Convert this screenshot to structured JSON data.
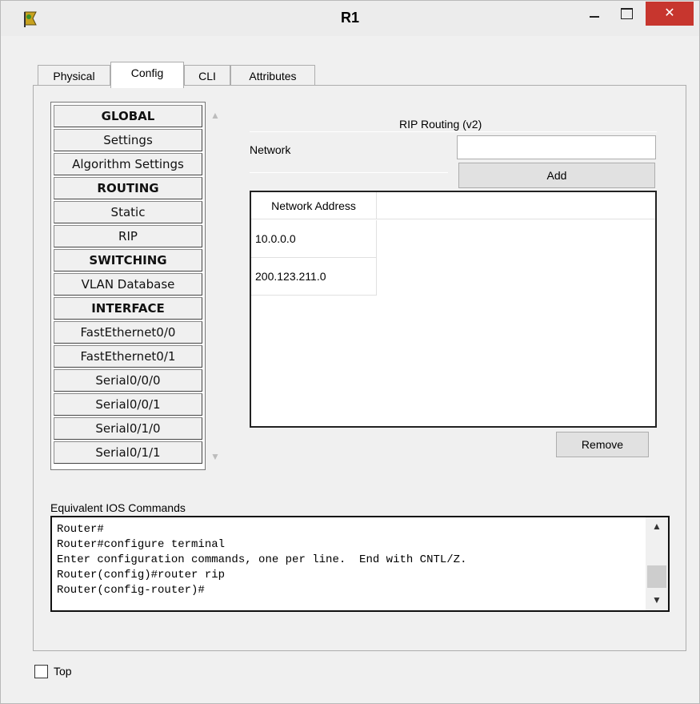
{
  "window": {
    "title": "R1",
    "icon": "router-app-icon",
    "close_glyph": "✕"
  },
  "tabs": [
    {
      "label": "Physical"
    },
    {
      "label": "Config"
    },
    {
      "label": "CLI"
    },
    {
      "label": "Attributes"
    }
  ],
  "active_tab": "Config",
  "nav": {
    "items": [
      {
        "label": "GLOBAL",
        "header": true
      },
      {
        "label": "Settings"
      },
      {
        "label": "Algorithm Settings"
      },
      {
        "label": "ROUTING",
        "header": true
      },
      {
        "label": "Static"
      },
      {
        "label": "RIP"
      },
      {
        "label": "SWITCHING",
        "header": true
      },
      {
        "label": "VLAN Database"
      },
      {
        "label": "INTERFACE",
        "header": true
      },
      {
        "label": "FastEthernet0/0"
      },
      {
        "label": "FastEthernet0/1"
      },
      {
        "label": "Serial0/0/0"
      },
      {
        "label": "Serial0/0/1"
      },
      {
        "label": "Serial0/1/0"
      },
      {
        "label": "Serial0/1/1"
      }
    ]
  },
  "rip": {
    "title": "RIP Routing (v2)",
    "network_label": "Network",
    "network_value": "",
    "add_label": "Add",
    "remove_label": "Remove",
    "table": {
      "header": "Network Address",
      "rows": [
        "10.0.0.0",
        "200.123.211.0"
      ]
    }
  },
  "ios": {
    "label": "Equivalent IOS Commands",
    "lines": [
      "Router#",
      "Router#configure terminal",
      "Enter configuration commands, one per line.  End with CNTL/Z.",
      "Router(config)#router rip",
      "Router(config-router)#"
    ]
  },
  "top_checkbox": {
    "label": "Top",
    "checked": false
  },
  "colors": {
    "close_button": "#c7362e",
    "window_bg": "#f0f0f0"
  }
}
